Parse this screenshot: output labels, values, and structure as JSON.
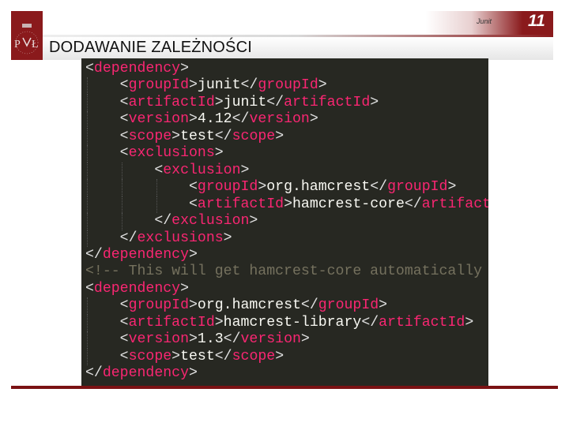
{
  "header": {
    "logo_text": "PŁ",
    "section_label": "Junit",
    "page_number": "11",
    "title": "DODAWANIE ZALEŻNOŚCI",
    "accent_color": "#8a1a1c"
  },
  "code": {
    "language": "xml",
    "lines": [
      {
        "indent": 0,
        "text": "<dependency>"
      },
      {
        "indent": 1,
        "text": "<groupId>junit</groupId>"
      },
      {
        "indent": 1,
        "text": "<artifactId>junit</artifactId>"
      },
      {
        "indent": 1,
        "text": "<version>4.12</version>"
      },
      {
        "indent": 1,
        "text": "<scope>test</scope>"
      },
      {
        "indent": 1,
        "text": "<exclusions>"
      },
      {
        "indent": 2,
        "text": "<exclusion>"
      },
      {
        "indent": 3,
        "text": "<groupId>org.hamcrest</groupId>"
      },
      {
        "indent": 3,
        "text": "<artifactId>hamcrest-core</artifactId>"
      },
      {
        "indent": 2,
        "text": "</exclusion>"
      },
      {
        "indent": 1,
        "text": "</exclusions>"
      },
      {
        "indent": 0,
        "text": "</dependency>"
      },
      {
        "indent": 0,
        "text": "<!-- This will get hamcrest-core automatically -->"
      },
      {
        "indent": 0,
        "text": "<dependency>"
      },
      {
        "indent": 1,
        "text": "<groupId>org.hamcrest</groupId>"
      },
      {
        "indent": 1,
        "text": "<artifactId>hamcrest-library</artifactId>"
      },
      {
        "indent": 1,
        "text": "<version>1.3</version>"
      },
      {
        "indent": 1,
        "text": "<scope>test</scope>"
      },
      {
        "indent": 0,
        "text": "</dependency>"
      }
    ]
  }
}
